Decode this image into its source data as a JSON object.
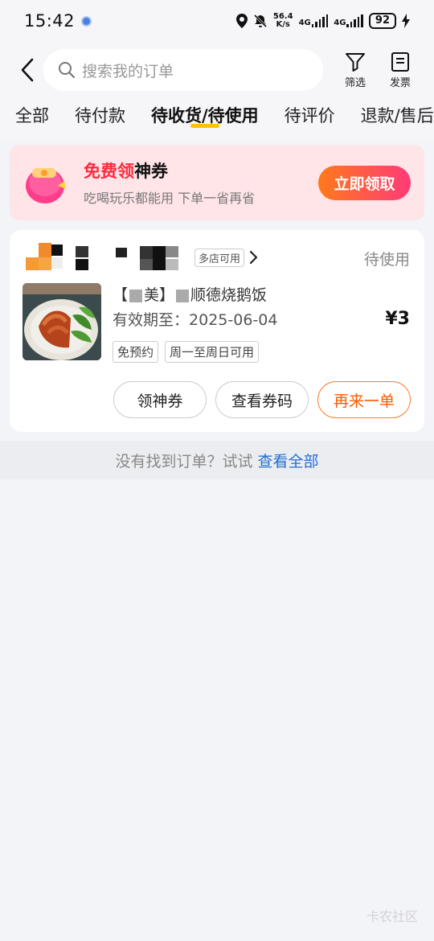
{
  "status_bar": {
    "time": "15:42",
    "net_speed_top": "56.4",
    "net_speed_bottom": "K/s",
    "sig1": "4G",
    "sig2": "4G",
    "battery": "92"
  },
  "header": {
    "search_placeholder": "搜索我的订单",
    "filter_label": "筛选",
    "invoice_label": "发票"
  },
  "tabs": [
    {
      "label": "全部"
    },
    {
      "label": "待付款"
    },
    {
      "label": "待收货/待使用",
      "active": true
    },
    {
      "label": "待评价"
    },
    {
      "label": "退款/售后"
    }
  ],
  "promo": {
    "title_highlight": "免费领",
    "title_rest": "神券",
    "subtitle": "吃喝玩乐都能用 下单一省再省",
    "button": "立即领取"
  },
  "order": {
    "multi_store_badge": "多店可用",
    "status": "待使用",
    "product_name_prefix": "【",
    "product_name_mid": "美】",
    "product_name": "顺德烧鹅饭",
    "validity_label": "有效期至：",
    "validity_date": "2025-06-04",
    "price": "¥3",
    "tags": [
      "免预约",
      "周一至周日可用"
    ],
    "actions": [
      "领神券",
      "查看券码",
      "再来一单"
    ]
  },
  "footer": {
    "hint": "没有找到订单？试试",
    "link": "查看全部"
  },
  "watermark": "卡农社区",
  "colors": {
    "accent_orange": "#ff5a00",
    "promo_red": "#ff2a3d",
    "link_blue": "#1f6fd1",
    "tab_underline": "#ffc300"
  }
}
